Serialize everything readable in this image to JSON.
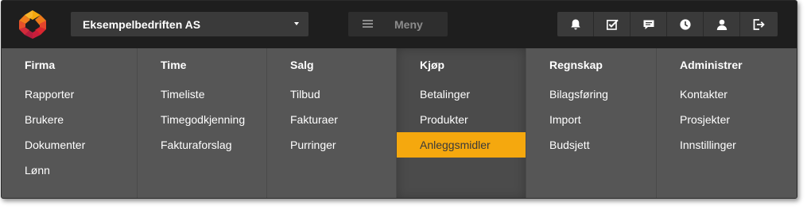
{
  "header": {
    "logo_icon": "hexagon-flower-logo",
    "company_name": "Eksempelbedriften AS",
    "menu_label": "Meny",
    "icons": [
      "bell-icon",
      "checkbox-icon",
      "chat-icon",
      "clock-icon",
      "user-icon",
      "logout-icon"
    ]
  },
  "menu": {
    "columns": [
      {
        "title": "Firma",
        "items": [
          "Rapporter",
          "Brukere",
          "Dokumenter",
          "Lønn"
        ]
      },
      {
        "title": "Time",
        "items": [
          "Timeliste",
          "Timegodkjenning",
          "Fakturaforslag"
        ]
      },
      {
        "title": "Salg",
        "items": [
          "Tilbud",
          "Fakturaer",
          "Purringer"
        ]
      },
      {
        "title": "Kjøp",
        "items": [
          "Betalinger",
          "Produkter",
          "Anleggsmidler"
        ]
      },
      {
        "title": "Regnskap",
        "items": [
          "Bilagsføring",
          "Import",
          "Budsjett"
        ]
      },
      {
        "title": "Administrer",
        "items": [
          "Kontakter",
          "Prosjekter",
          "Innstillinger"
        ]
      }
    ],
    "active_column": "Kjøp",
    "selected_item": "Anleggsmidler"
  },
  "colors": {
    "topbar": "#1e1e1e",
    "menu_bg": "#565656",
    "highlight": "#f5a80e"
  }
}
